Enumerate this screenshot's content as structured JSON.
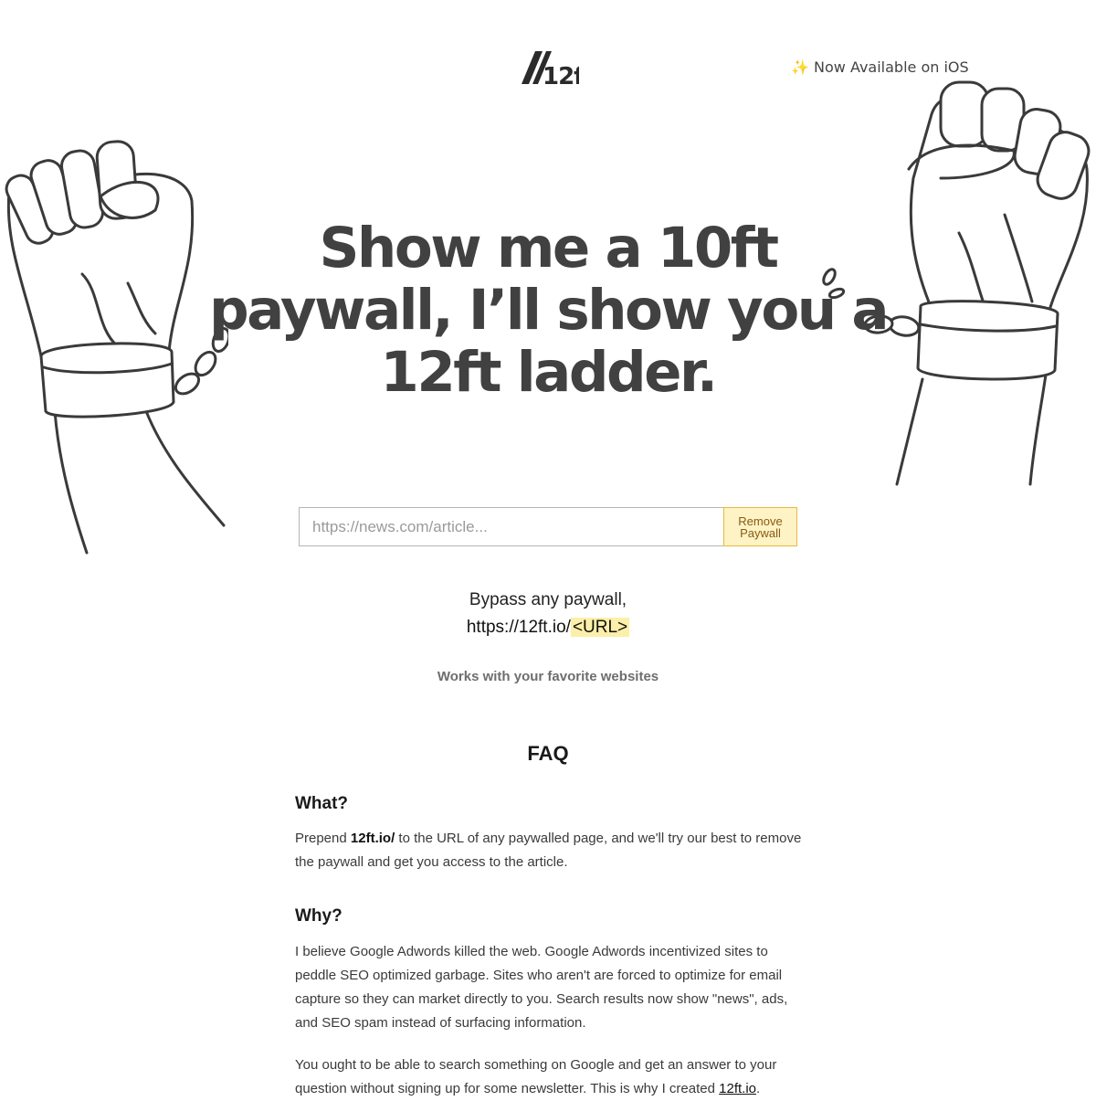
{
  "header": {
    "logo_text": "12ft",
    "ios_link": "✨ Now Available on iOS"
  },
  "hero": {
    "line1": "Show me a 10ft",
    "line2": "paywall, I’ll show you a",
    "line3": "12ft ladder."
  },
  "form": {
    "url_placeholder": "https://news.com/article...",
    "url_value": "",
    "button_line1": "Remove",
    "button_line2": "Paywall"
  },
  "bypass": {
    "line1": "Bypass any paywall,",
    "prefix": "https://12ft.io/",
    "url_tag": "<URL>"
  },
  "works_with": "Works with your favorite websites",
  "faq": {
    "title": "FAQ",
    "q1": {
      "question": "What?",
      "text_before": "Prepend ",
      "bold": "12ft.io/",
      "text_after": " to the URL of any paywalled page, and we'll try our best to remove the paywall and get you access to the article."
    },
    "q2": {
      "question": "Why?",
      "para1": "I believe Google Adwords killed the web. Google Adwords incentivized sites to peddle SEO optimized garbage. Sites who aren't are forced to optimize for email capture so they can market directly to you. Search results now show \"news\", ads, and SEO spam instead of surfacing information.",
      "para2_before": "You ought to be able to search something on Google and get an answer to your question without signing up for some newsletter. This is why I created ",
      "para2_link": "12ft.io",
      "para2_after": "."
    }
  },
  "colors": {
    "hero_text": "#414141",
    "button_bg": "#fdf3c4",
    "button_border": "#e9b840",
    "url_highlight": "#fcefa9"
  },
  "icons": {
    "left_art": "raised-fist-broken-shackle-icon",
    "right_art": "raised-fist-broken-shackle-icon",
    "ios_emoji": "sparkles"
  }
}
